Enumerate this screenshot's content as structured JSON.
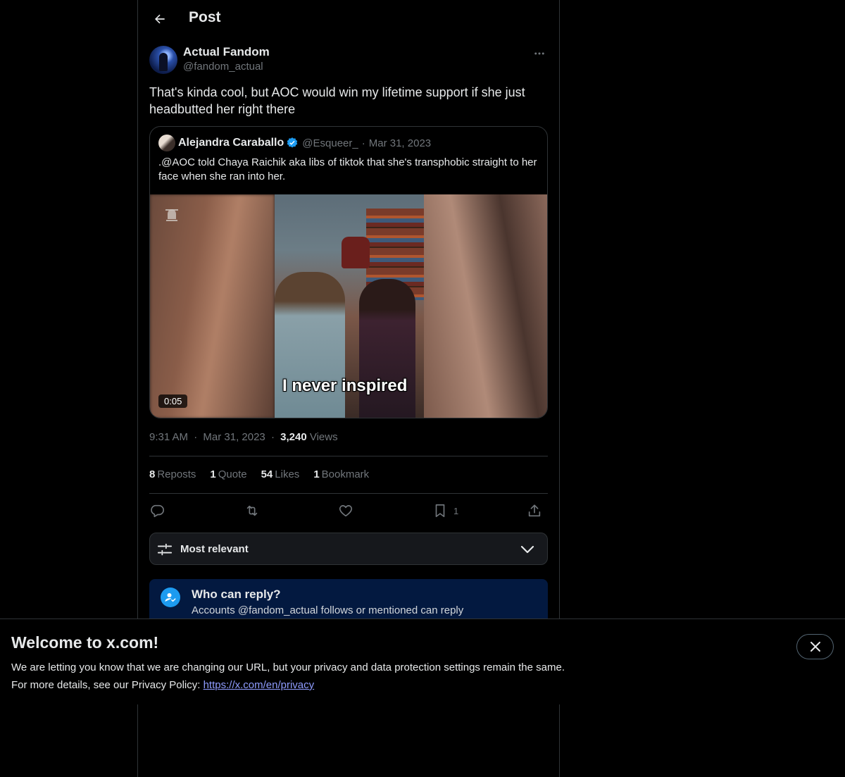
{
  "header": {
    "title": "Post"
  },
  "post": {
    "author_name": "Actual Fandom",
    "author_handle": "@fandom_actual",
    "text": "That's kinda cool, but AOC would win my lifetime support if she just headbutted her right there",
    "time": "9:31 AM",
    "sep1": "·",
    "date": "Mar 31, 2023",
    "sep2": "·",
    "views_count": "3,240",
    "views_label": "Views"
  },
  "quote": {
    "author_name": "Alejandra Caraballo",
    "author_handle": "@Esqueer_",
    "sep": "·",
    "date": "Mar 31, 2023",
    "text": ".@AOC told Chaya Raichik aka libs of tiktok that she's transphobic straight to her face when she ran into her.",
    "video_caption": "I never inspired",
    "duration": "0:05"
  },
  "stats": {
    "reposts": {
      "count": "8",
      "label": "Reposts"
    },
    "quotes": {
      "count": "1",
      "label": "Quote"
    },
    "likes": {
      "count": "54",
      "label": "Likes"
    },
    "bookmarks": {
      "count": "1",
      "label": "Bookmark"
    }
  },
  "actions": {
    "reply_icon": "reply-icon",
    "repost_icon": "repost-icon",
    "like_icon": "heart-icon",
    "bookmark_icon": "bookmark-icon",
    "bookmark_count": "1",
    "share_icon": "share-icon"
  },
  "sort": {
    "label": "Most relevant"
  },
  "reply_restriction": {
    "title": "Who can reply?",
    "subtitle": "Accounts @fandom_actual follows or mentioned can reply"
  },
  "cookie_banner": {
    "title": "Welcome to x.com!",
    "line1": "We are letting you know that we are changing our URL, but your privacy and data protection settings remain the same.",
    "line2_prefix": "For more details, see our Privacy Policy: ",
    "link_text": "https://x.com/en/privacy"
  },
  "colors": {
    "background": "#000000",
    "text": "#e7e9ea",
    "secondary_text": "#71767b",
    "border": "#2f3336",
    "accent_blue": "#1d9bf0",
    "reply_box": "#031940",
    "link": "#8f9cff"
  }
}
